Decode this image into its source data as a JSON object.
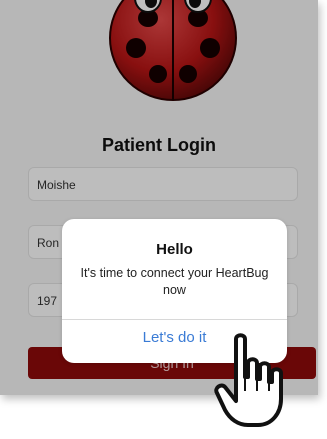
{
  "login": {
    "title": "Patient Login",
    "first_name_value": "Moishe",
    "last_name_value": "Ron",
    "dob_value": "197",
    "sign_in_label": "Sign In"
  },
  "alert": {
    "title": "Hello",
    "message": "It's time to connect your HeartBug now",
    "action_label": "Let's do it"
  },
  "colors": {
    "brand_red": "#8e0a0a",
    "alert_link": "#3a7bd5"
  },
  "icons": {
    "logo": "ladybug-logo",
    "pointer": "hand-pointer-icon"
  }
}
